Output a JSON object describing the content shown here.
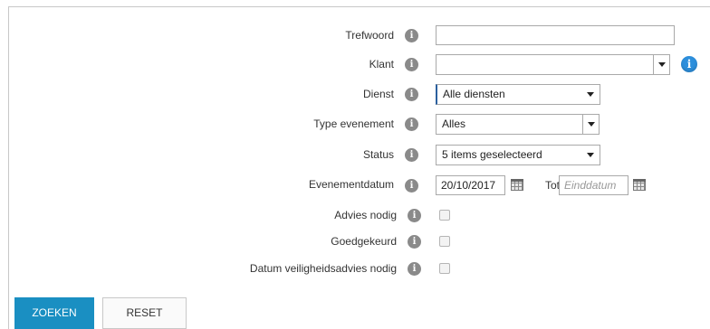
{
  "fields": {
    "trefwoord": {
      "label": "Trefwoord",
      "value": ""
    },
    "klant": {
      "label": "Klant",
      "value": ""
    },
    "dienst": {
      "label": "Dienst",
      "value": "Alle diensten"
    },
    "type_evenement": {
      "label": "Type evenement",
      "value": "Alles"
    },
    "status": {
      "label": "Status",
      "value": "5 items geselecteerd"
    },
    "evenementdatum": {
      "label": "Evenementdatum",
      "value": "20/10/2017",
      "tot_label": "Tot:",
      "end_placeholder": "Einddatum"
    },
    "advies_nodig": {
      "label": "Advies nodig",
      "checked": false
    },
    "goedgekeurd": {
      "label": "Goedgekeurd",
      "checked": false
    },
    "datum_veiligheidsadvies": {
      "label": "Datum veiligheidsadvies nodig",
      "checked": false
    }
  },
  "icons": {
    "field_info": "info-icon",
    "klant_info": "info-circle-icon",
    "calendar": "calendar-icon"
  },
  "colors": {
    "primary": "#1a8fc2",
    "info_blue": "#2d8fdc",
    "info_gray": "#8a8a8a"
  },
  "buttons": {
    "search": "ZOEKEN",
    "reset": "RESET"
  }
}
